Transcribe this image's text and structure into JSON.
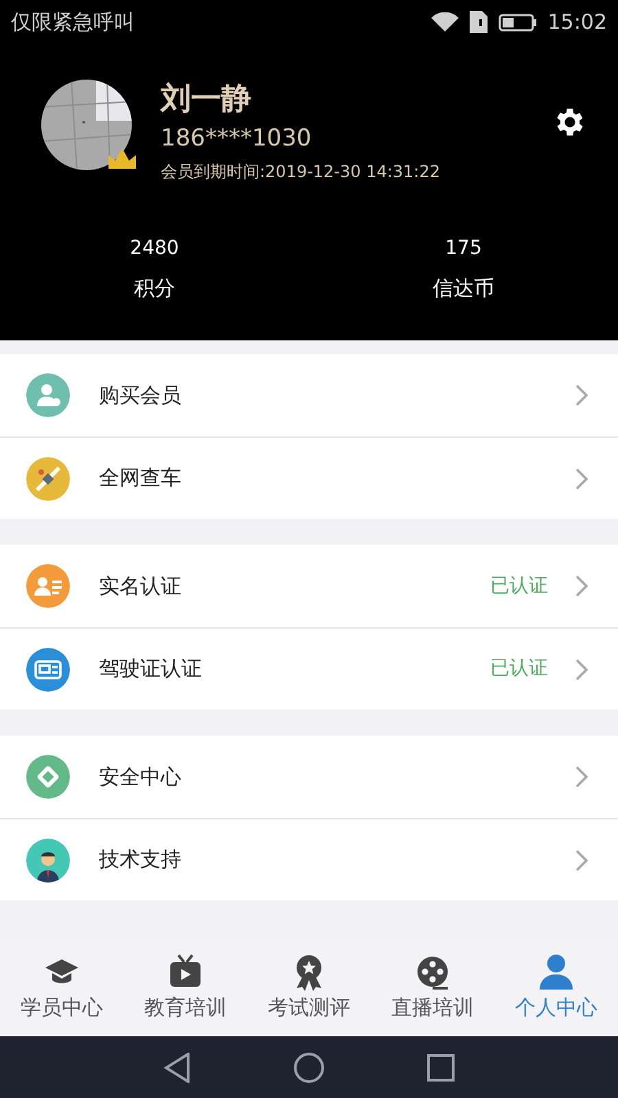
{
  "status_bar": {
    "notice": "仅限紧急呼叫",
    "time": "15:02"
  },
  "profile": {
    "name": "刘一静",
    "phone": "186****1030",
    "expiry": "会员到期时间:2019-12-30 14:31:22",
    "vip": true
  },
  "stats": [
    {
      "value": "2480",
      "label": "积分"
    },
    {
      "value": "175",
      "label": "信达币"
    }
  ],
  "menu_groups": [
    [
      {
        "label": "购买会员"
      },
      {
        "label": "全网查车"
      }
    ],
    [
      {
        "label": "实名认证",
        "status": "已认证"
      },
      {
        "label": "驾驶证认证",
        "status": "已认证"
      }
    ],
    [
      {
        "label": "安全中心"
      },
      {
        "label": "技术支持"
      }
    ]
  ],
  "tabs": [
    {
      "label": "学员中心",
      "selected": false
    },
    {
      "label": "教育培训",
      "selected": false
    },
    {
      "label": "考试测评",
      "selected": false
    },
    {
      "label": "直播培训",
      "selected": false
    },
    {
      "label": "个人中心",
      "selected": true
    }
  ]
}
